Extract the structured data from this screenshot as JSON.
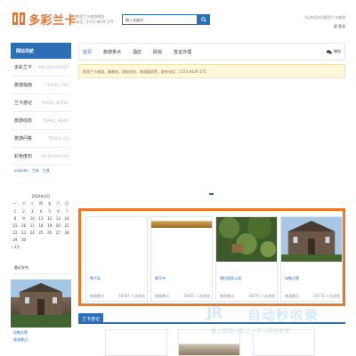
{
  "header": {
    "logo_text": "多彩兰卡",
    "info_line1": "斯里兰卡旅游领航",
    "info_line2": "电话：1373 8439 175",
    "search_placeholder": "输入关键词",
    "welcome": "Hi,欢迎访问斯里兰卡旅游",
    "register": "请 登录"
  },
  "sidebar": {
    "title": "网站导航",
    "items": [
      {
        "zh": "多彩兰卡",
        "en": "UNCATEGORIZED"
      },
      {
        "zh": "旅游指南",
        "en": "TRAVEL_TIPS"
      },
      {
        "zh": "兰卡游记",
        "en": "TRAVEL_NOTES"
      },
      {
        "zh": "旅游动态",
        "en": "TRAVEL_NEWS"
      },
      {
        "zh": "旅游问答",
        "en": "TRAVEL_QA"
      },
      {
        "zh": "彩色度石",
        "en": "CAI-SE-BAO-SHI"
      }
    ],
    "tags": "srilanka　工具　工具"
  },
  "calendar": {
    "title": "2024年4月",
    "weekdays": [
      "一",
      "二",
      "三",
      "四",
      "五",
      "六",
      "日"
    ],
    "days": [
      "1",
      "2",
      "3",
      "4",
      "5",
      "6",
      "7",
      "8",
      "9",
      "10",
      "11",
      "12",
      "13",
      "14",
      "15",
      "16",
      "17",
      "18",
      "19",
      "20",
      "21",
      "22",
      "23",
      "24",
      "25",
      "26",
      "27",
      "28",
      "29",
      "30",
      "",
      "",
      "",
      "",
      ""
    ],
    "prev": "« 3月"
  },
  "recent": {
    "title": "最近发布",
    "caption1": "加勒古堡",
    "caption2": "旅游景点"
  },
  "nav": {
    "items": [
      "首页",
      "旅游景点",
      "酒店",
      "民俗",
      "签证办理"
    ],
    "right_label": "微信"
  },
  "notice": "斯里兰卡旅游，精美线，国际民俗，旅游路线等，联系电话：1373 8439 175",
  "featured": [
    {
      "title": "狮子岩",
      "category": "旅游景点",
      "views": "16787 人次浏览"
    },
    {
      "title": "佛牙寺",
      "category": "旅游景点",
      "views": "16655 人次浏览"
    },
    {
      "title": "雅拉国家公园",
      "category": "旅游景点",
      "views": "16775 人次浏览"
    },
    {
      "title": "加勒古堡",
      "category": "旅游景点",
      "views": "16772 人次浏览"
    }
  ],
  "section2": {
    "label": "兰卡游记"
  },
  "watermark": {
    "logo": "JR",
    "text": "自动秒收录",
    "sub": "做上链接→来访一次→自动收录"
  }
}
